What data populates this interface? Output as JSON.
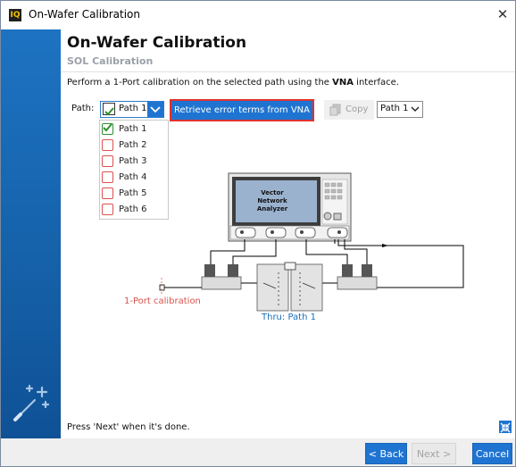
{
  "window": {
    "app_icon_text": "IQ",
    "title": "On-Wafer Calibration",
    "close_glyph": "✕"
  },
  "header": {
    "title": "On-Wafer Calibration",
    "subtitle": "SOL Calibration"
  },
  "instruction": {
    "before": "Perform a 1-Port calibration on the selected path using the ",
    "bold": "VNA",
    "after": " interface."
  },
  "toolbar": {
    "path_label": "Path:",
    "path_combo_value": "Path 1",
    "retrieve_label": "Retrieve error terms from VNA",
    "copy_label": "Copy",
    "copy_target_value": "Path 1"
  },
  "dropdown": {
    "items": [
      {
        "label": "Path 1",
        "checked": true
      },
      {
        "label": "Path 2",
        "checked": false
      },
      {
        "label": "Path 3",
        "checked": false
      },
      {
        "label": "Path 4",
        "checked": false
      },
      {
        "label": "Path 5",
        "checked": false
      },
      {
        "label": "Path 6",
        "checked": false
      }
    ]
  },
  "diagram": {
    "vna_line1": "Vector",
    "vna_line2": "Network",
    "vna_line3": "Analyzer",
    "one_port_label": "1-Port calibration",
    "thru_label": "Thru: Path 1"
  },
  "footer": {
    "message": "Press 'Next' when it's done.",
    "back_label": "< Back",
    "next_label": "Next >",
    "cancel_label": "Cancel"
  },
  "colors": {
    "accent": "#1f74d1",
    "highlight_border": "#e0322e",
    "check_green": "#2f8f2f",
    "unchecked_red": "#d9534f",
    "thru_label": "#1a6fb8"
  },
  "icons": [
    "app-iq-icon",
    "close-icon",
    "chevron-down-icon",
    "copy-icon",
    "wand-icon",
    "collapse-icon"
  ]
}
